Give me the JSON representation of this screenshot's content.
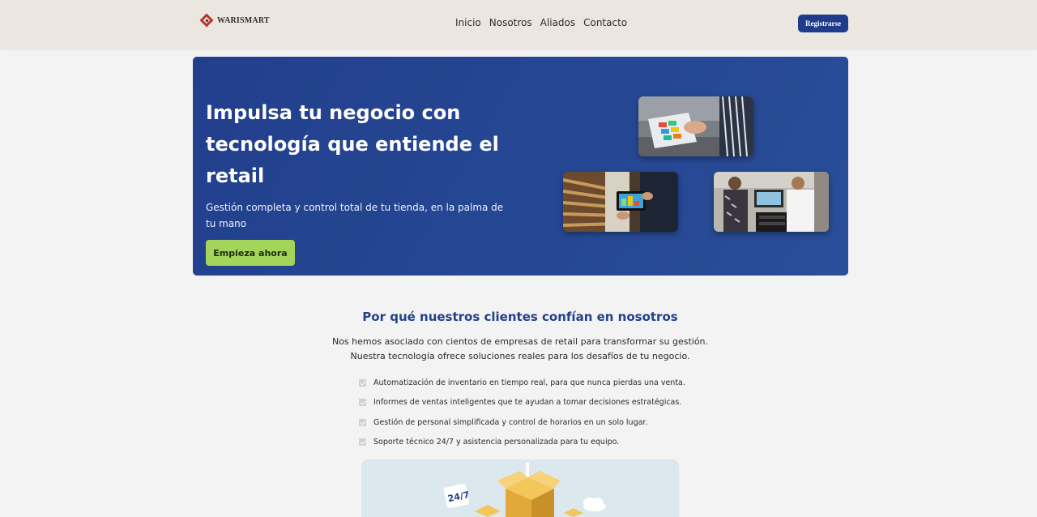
{
  "header": {
    "brand": "WARISMART",
    "nav": [
      "Inicio",
      "Nosotros",
      "Aliados",
      "Contacto"
    ],
    "register_label": "Registrarse"
  },
  "hero": {
    "title": "Impulsa tu negocio con tecnología que entiende el retail",
    "subtitle": "Gestión completa y control total de tu tienda, en la palma de tu mano",
    "cta_label": "Empieza ahora",
    "photos": [
      "pos-terminal-photo",
      "warehouse-tablet-photo",
      "team-computer-photo"
    ]
  },
  "trust": {
    "title": "Por qué nuestros clientes confían en nosotros",
    "description_line1": "Nos hemos asociado con cientos de empresas de retail para transformar su gestión.",
    "description_line2": "Nuestra tecnología ofrece soluciones reales para los desafíos de tu negocio.",
    "features": [
      "Automatización de inventario en tiempo real, para que nunca pierdas una venta.",
      "Informes de ventas inteligentes que te ayudan a tomar decisiones estratégicas.",
      "Gestión de personal simplificada y control de horarios en un solo lugar.",
      "Soporte técnico 24/7 y asistencia personalizada para tu equipo."
    ],
    "illustration_badge": "24/7"
  },
  "colors": {
    "header_bg": "#ebe6e0",
    "hero_bg": "#264894",
    "primary": "#1f3b8c",
    "cta": "#a3d55a",
    "title_blue": "#23408a"
  }
}
